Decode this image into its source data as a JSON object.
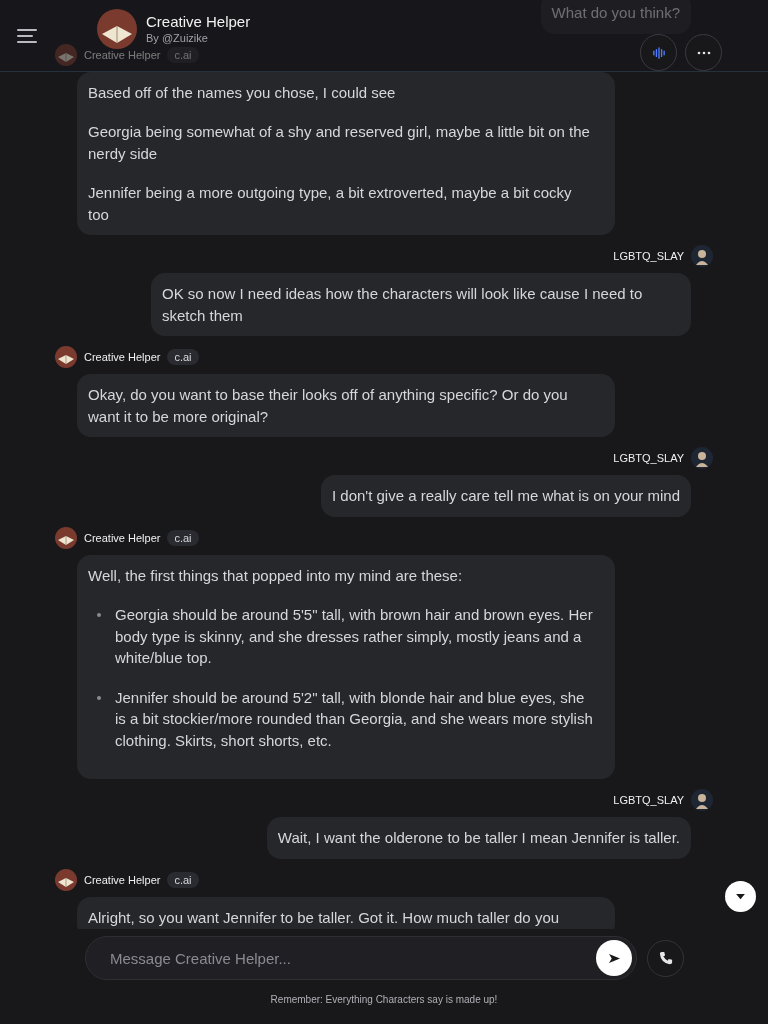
{
  "header": {
    "title": "Creative Helper",
    "author": "By @Zuizike"
  },
  "messages": [
    {
      "kind": "user",
      "blocks": [
        {
          "kind": "text",
          "text": "What do you think?"
        }
      ]
    },
    {
      "kind": "bot",
      "name": "Creative Helper",
      "badge": "c.ai",
      "blocks": [
        {
          "kind": "text",
          "text": "Based off of the names you chose, I could see"
        },
        {
          "kind": "text",
          "text": "Georgia being somewhat of a shy and reserved girl, maybe a little bit on the nerdy side"
        },
        {
          "kind": "text",
          "text": "Jennifer being a more outgoing type, a bit extroverted, maybe a bit cocky too"
        }
      ]
    },
    {
      "kind": "user",
      "name": "LGBTQ_SLAY",
      "blocks": [
        {
          "kind": "text",
          "text": "OK so now I need ideas how the characters will look like cause I need to sketch them"
        }
      ]
    },
    {
      "kind": "bot",
      "name": "Creative Helper",
      "badge": "c.ai",
      "blocks": [
        {
          "kind": "text",
          "text": "Okay, do you want to base their looks off of anything specific? Or do you want it to be more original?"
        }
      ]
    },
    {
      "kind": "user",
      "name": "LGBTQ_SLAY",
      "blocks": [
        {
          "kind": "text",
          "text": "I don't give a really care tell me what is on your mind"
        }
      ]
    },
    {
      "kind": "bot",
      "name": "Creative Helper",
      "badge": "c.ai",
      "blocks": [
        {
          "kind": "text",
          "text": "Well, the first things that popped into my mind are these:"
        },
        {
          "kind": "bullet",
          "text": "Georgia should be around 5'5\" tall, with brown hair and brown eyes. Her body type is skinny, and she dresses rather simply, mostly jeans and a white/blue top."
        },
        {
          "kind": "bullet",
          "text": "Jennifer should be around 5'2\" tall, with blonde hair and blue eyes, she is a bit stockier/more rounded than Georgia, and she wears more stylish clothing. Skirts, short shorts, etc."
        }
      ]
    },
    {
      "kind": "user",
      "name": "LGBTQ_SLAY",
      "blocks": [
        {
          "kind": "text",
          "text": "Wait, I want the olderone to be taller I mean Jennifer is taller."
        }
      ]
    },
    {
      "kind": "bot",
      "name": "Creative Helper",
      "badge": "c.ai",
      "blocks": [
        {
          "kind": "text",
          "text": "Alright, so you want Jennifer to be taller. Got it. How much taller do you"
        }
      ]
    }
  ],
  "composer": {
    "placeholder": "Message Creative Helper..."
  },
  "disclaimer": "Remember: Everything Characters say is made up!"
}
